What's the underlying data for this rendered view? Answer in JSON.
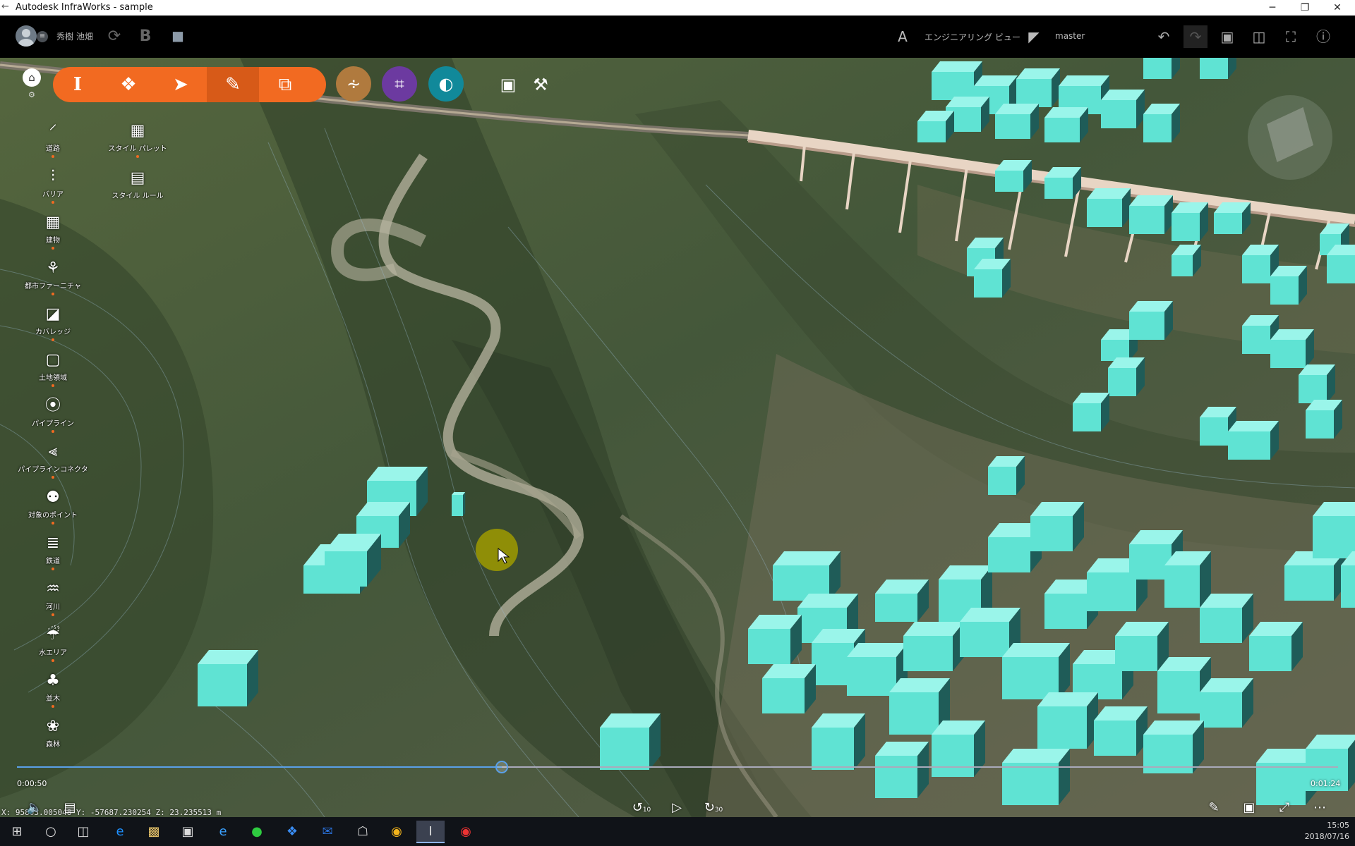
{
  "window": {
    "title": "Autodesk InfraWorks - sample",
    "controls": [
      "─",
      "❐",
      "✕"
    ]
  },
  "appbar": {
    "username": "秀樹 池畑",
    "view_label": "エンジニアリング ビュー",
    "branch_label": "master"
  },
  "toolbar": {
    "home_glyph": "⌂",
    "gear_glyph": "⚙"
  },
  "palette": {
    "style_palette": "スタイル パレット",
    "style_rule": "スタイル ルール",
    "items": [
      {
        "label": "道路",
        "icon": "road-icon"
      },
      {
        "label": "バリア",
        "icon": "barrier-icon"
      },
      {
        "label": "建物",
        "icon": "building-icon"
      },
      {
        "label": "都市ファーニチャ",
        "icon": "city-furniture-icon"
      },
      {
        "label": "カバレッジ",
        "icon": "coverage-icon"
      },
      {
        "label": "土地領域",
        "icon": "land-area-icon"
      },
      {
        "label": "パイプライン",
        "icon": "pipeline-icon"
      },
      {
        "label": "パイプラインコネクタ",
        "icon": "pipeline-connector-icon"
      },
      {
        "label": "対象のポイント",
        "icon": "point-of-interest-icon"
      },
      {
        "label": "鉄道",
        "icon": "railway-icon"
      },
      {
        "label": "河川",
        "icon": "river-icon"
      },
      {
        "label": "水エリア",
        "icon": "water-area-icon"
      },
      {
        "label": "並木",
        "icon": "tree-row-icon"
      },
      {
        "label": "森林",
        "icon": "forest-icon"
      }
    ]
  },
  "playback": {
    "current_time": "0:00:50",
    "total_time": "0:01:24",
    "progress": 0.367,
    "rewind_label": "10",
    "forward_label": "30"
  },
  "status": {
    "coordinates": "X: 95803.005048 Y: -57687.230254 Z: 23.235513 m"
  },
  "taskbar": {
    "time": "15:05",
    "date": "2018/07/16"
  },
  "colors": {
    "accent": "#f26a21",
    "building": "#5fe3d3",
    "timeline": "#5aa0e8"
  }
}
